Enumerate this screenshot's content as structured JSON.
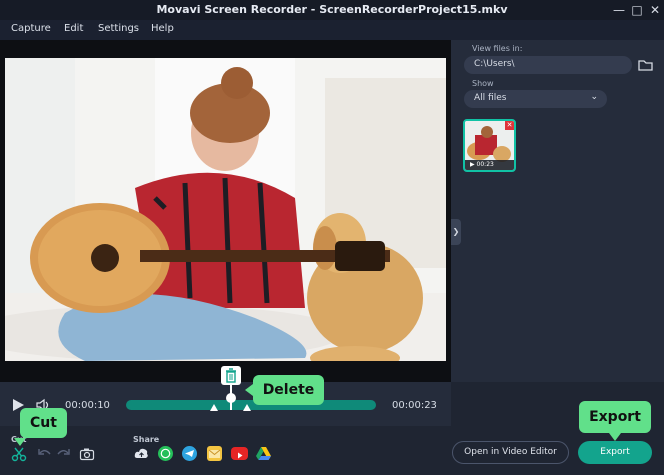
{
  "window": {
    "title": "Movavi Screen Recorder - ScreenRecorderProject15.mkv"
  },
  "menu": [
    "Capture",
    "Edit",
    "Settings",
    "Help"
  ],
  "right_panel": {
    "view_files_label": "View files in:",
    "path_value": "C:\\Users\\",
    "show_label": "Show",
    "show_selected": "All files",
    "thumbnail_duration": "00:23"
  },
  "player": {
    "current_time": "00:00:10",
    "total_time": "00:00:23",
    "progress_fraction": 0.43
  },
  "bottom": {
    "cut_section_label": "Cut",
    "share_label": "Share",
    "open_editor_label": "Open in Video Editor",
    "export_label": "Export"
  },
  "callouts": {
    "delete": "Delete",
    "cut": "Cut",
    "export": "Export"
  },
  "icons": [
    "play-icon",
    "volume-icon",
    "trash-icon",
    "scissors-icon",
    "undo-icon",
    "redo-icon",
    "camera-icon",
    "cloud-upload-icon",
    "whatsapp-icon",
    "telegram-icon",
    "email-icon",
    "youtube-icon",
    "google-drive-icon",
    "folder-icon",
    "chevron-down-icon",
    "close-icon",
    "collapse-arrow-icon"
  ],
  "colors": {
    "accent": "#13a48d",
    "timeline_track": "#0f8a79",
    "callout": "#61e08a",
    "close_red": "#e0333a"
  }
}
